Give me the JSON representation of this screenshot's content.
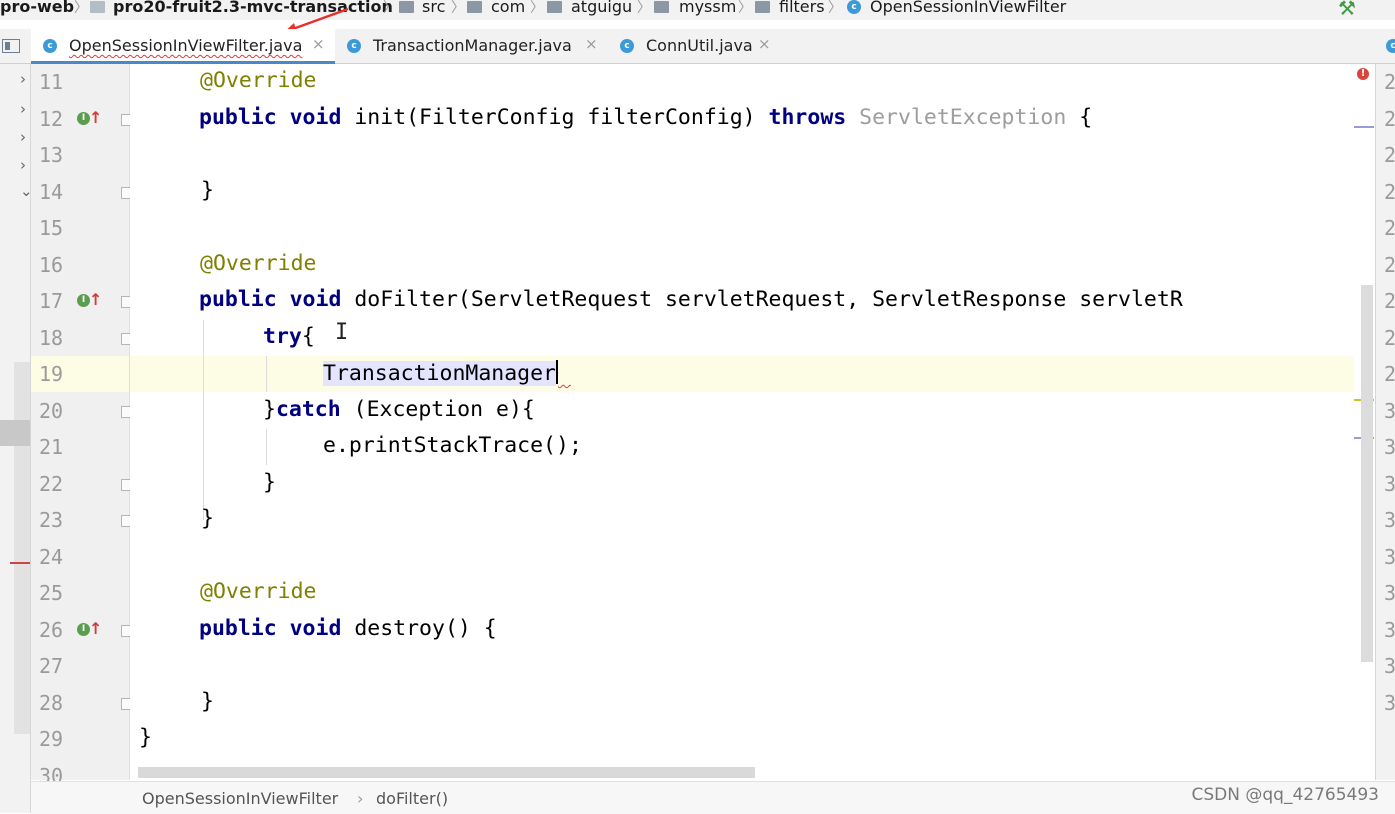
{
  "breadcrumb": {
    "items": [
      "pro-web",
      "pro20-fruit2.3-mvc-transaction",
      "src",
      "com",
      "atguigu",
      "myssm",
      "filters",
      "OpenSessionInViewFilter"
    ]
  },
  "tabs": [
    {
      "label": "OpenSessionInViewFilter.java",
      "close": "×",
      "icon": "c"
    },
    {
      "label": "TransactionManager.java",
      "close": "×",
      "icon": "c"
    },
    {
      "label": "ConnUtil.java",
      "close": "×",
      "icon": "c"
    }
  ],
  "gutter": {
    "line_numbers": [
      "11",
      "12",
      "13",
      "14",
      "15",
      "16",
      "17",
      "18",
      "19",
      "20",
      "21",
      "22",
      "23",
      "24",
      "25",
      "26",
      "27",
      "28",
      "29",
      "30"
    ],
    "impl_icon_text": "I",
    "impl_arrow": "↑"
  },
  "code": {
    "l11": "@Override",
    "l12_kw": "public void",
    "l12_a": " init(FilterConfig filterConfig) ",
    "l12_kw2": "throws",
    "l12_gray": " ServletException",
    "l12_b": " {",
    "l14": "}",
    "l16": "@Override",
    "l17_kw": "public void",
    "l17_a": " doFilter(ServletRequest servletRequest, ServletResponse servletR",
    "l18_kw": "try",
    "l18_a": "{",
    "l19": "TransactionManager",
    "l20_a": "}",
    "l20_kw": "catch",
    "l20_b": " (Exception e){",
    "l21": "e.printStackTrace();",
    "l22": "}",
    "l23": "}",
    "l25": "@Override",
    "l26_kw": "public void",
    "l26_a": " destroy() {",
    "l28": "}",
    "l29": "}"
  },
  "right_panel": {
    "digits": [
      "2",
      "2",
      "2",
      "2",
      "2",
      "2",
      "2",
      "2",
      "2",
      "3",
      "3",
      "3",
      "3",
      "3",
      "3",
      "3",
      "3",
      "3"
    ]
  },
  "status": {
    "crumb1": "OpenSessionInViewFilter",
    "sep": "›",
    "crumb2": "doFilter()",
    "watermark": "CSDN @qq_42765493"
  },
  "colors": {
    "keyword": "#000080",
    "annotation": "#808000",
    "current_line": "#fdfce4",
    "error": "#d9453b"
  }
}
